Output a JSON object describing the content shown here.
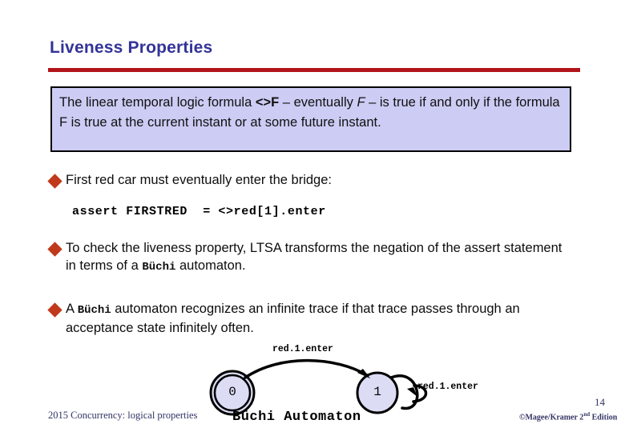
{
  "slide": {
    "title": "Liveness Properties",
    "page_number": "14",
    "accent_colors": {
      "title_blue": "#333399",
      "rule_red": "#b21419",
      "bullet_red": "#c0391b",
      "box_fill": "#ccccf4",
      "state_fill": "#dcdcf5"
    }
  },
  "definition_box": {
    "part_1": "The linear temporal logic formula ",
    "operator": "<>F",
    "part_2": " – eventually ",
    "formula_italic": "F",
    "part_3": " – is true if and only if the formula F is true at the current instant or at some future instant."
  },
  "bullets": [
    {
      "id": "first-red-car",
      "text": "First red car must eventually enter the bridge:"
    },
    {
      "id": "ltsa-transform",
      "before": "To check the liveness property, LTSA transforms the negation of the assert statement in terms of a ",
      "buchi": "Büchi",
      "after": " automaton."
    },
    {
      "id": "buchi-recognizes",
      "before": "A ",
      "buchi": "Büchi",
      "after": " automaton recognizes an infinite trace if that trace passes through an acceptance state infinitely often."
    }
  ],
  "code": {
    "assert_line": "assert FIRSTRED  = <>red[1].enter"
  },
  "automaton": {
    "caption": "Büchi Automaton",
    "states": [
      {
        "id": "state-0",
        "label": "0",
        "accepting": true
      },
      {
        "id": "state-1",
        "label": "1",
        "accepting": false
      }
    ],
    "transitions": [
      {
        "id": "t0",
        "from": "0",
        "to": "1",
        "label": "red.1.enter"
      },
      {
        "id": "t1",
        "from": "1",
        "to": "1",
        "label": "red.1.enter"
      }
    ]
  },
  "footer": {
    "left": "2015 Concurrency: logical properties",
    "copyright_prefix": "©Magee/Kramer 2",
    "copyright_sup": "nd",
    "copyright_suffix": " Edition"
  }
}
